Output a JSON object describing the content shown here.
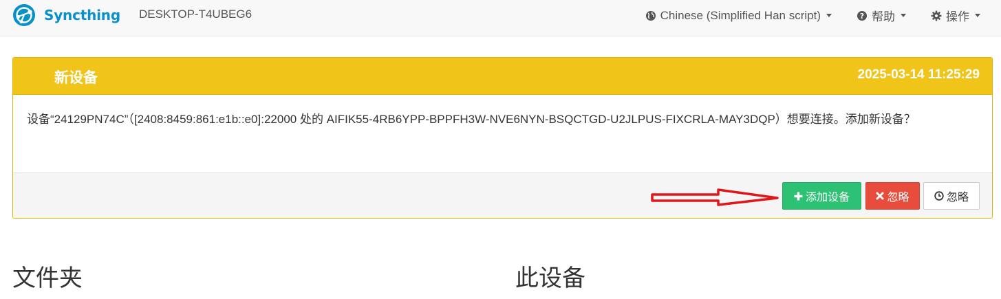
{
  "app": {
    "brand": "Syncthing",
    "device_name": "DESKTOP-T4UBEG6"
  },
  "nav": {
    "language": "Chinese (Simplified Han script)",
    "help": "帮助",
    "actions": "操作"
  },
  "notification": {
    "title": "新设备",
    "timestamp": "2025-03-14 11:25:29",
    "message": "设备“24129PN74C”（[2408:8459:861:e1b::e0]:22000 处的 AIFIK55-4RB6YPP-BPPFH3W-NVE6NYN-BSQCTGD-U2JLPUS-FIXCRLA-MAY3DQP）想要连接。添加新设备？",
    "buttons": {
      "add": "添加设备",
      "ignore": "忽略",
      "later": "忽略"
    }
  },
  "sections": {
    "folders": "文件夹",
    "this_device": "此设备"
  },
  "colors": {
    "brand": "#0891c9",
    "warning_panel": "#f0c419",
    "add_button": "#2dc273",
    "ignore_button": "#e74c3c",
    "annotation_arrow": "#e0161b"
  },
  "icons": {
    "logo": "syncthing-logo",
    "language": "globe-icon",
    "help": "question-circle-icon",
    "actions": "gear-icon",
    "add": "plus-icon",
    "ignore": "times-icon",
    "later": "clock-icon"
  }
}
